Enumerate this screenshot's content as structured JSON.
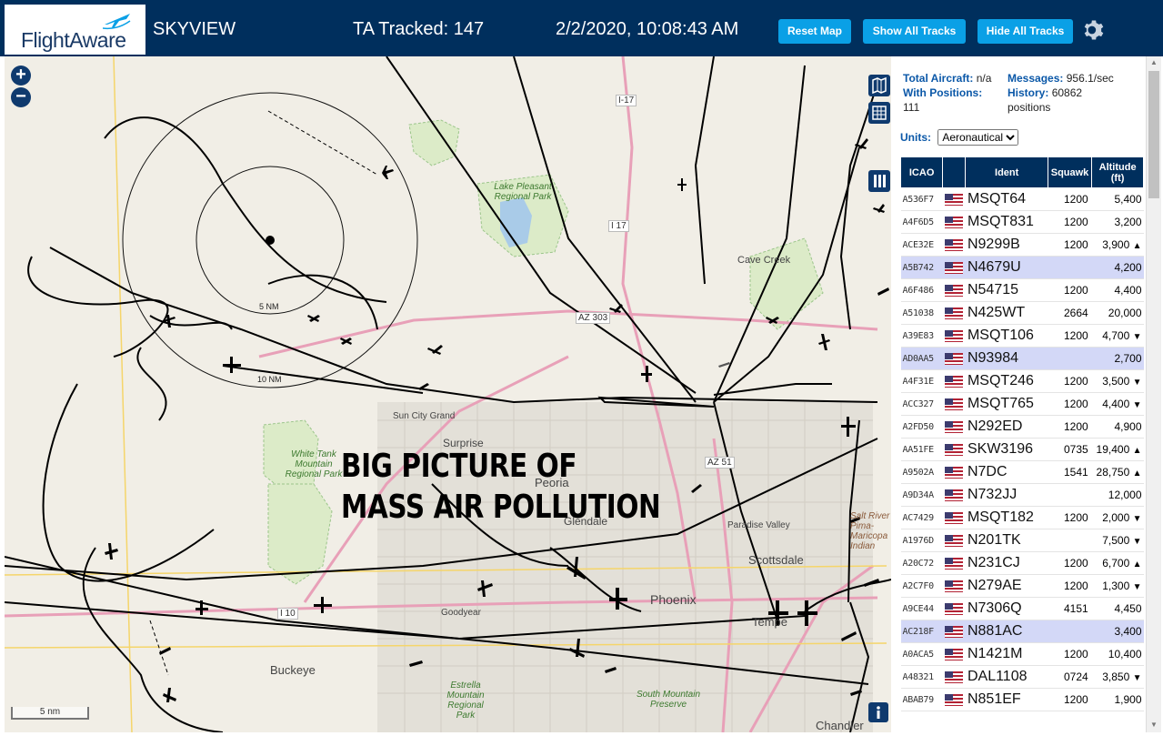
{
  "header": {
    "logo_text": "FlightAware",
    "title": "SKYVIEW",
    "tracked": "TA Tracked: 147",
    "datetime": "2/2/2020, 10:08:43 AM",
    "reset_label": "Reset Map",
    "show_label": "Show All Tracks",
    "hide_label": "Hide All Tracks"
  },
  "map": {
    "overlay_line1": "BIG PICTURE OF",
    "overlay_line2": "MASS AIR POLLUTION",
    "scale_label": "5 nm",
    "labels": [
      {
        "text": "I-17"
      },
      {
        "text": "I 17"
      },
      {
        "text": "Lake Pleasant Regional Park"
      },
      {
        "text": "Cave Creek"
      },
      {
        "text": "AZ 303"
      },
      {
        "text": "Sun City Grand"
      },
      {
        "text": "Surprise"
      },
      {
        "text": "White Tank Mountain Regional Park"
      },
      {
        "text": "Peoria"
      },
      {
        "text": "Glendale"
      },
      {
        "text": "AZ 51"
      },
      {
        "text": "Paradise Valley"
      },
      {
        "text": "Scottsdale"
      },
      {
        "text": "Phoenix"
      },
      {
        "text": "Tempe"
      },
      {
        "text": "Goodyear"
      },
      {
        "text": "I 10"
      },
      {
        "text": "Buckeye"
      },
      {
        "text": "Estrella Mountain Regional Park"
      },
      {
        "text": "South Mountain Preserve"
      },
      {
        "text": "Chandler"
      },
      {
        "text": "10 NM"
      },
      {
        "text": "5 NM"
      },
      {
        "text": "Salt River Pima-Maricopa Indian"
      }
    ]
  },
  "panel": {
    "total_label": "Total Aircraft:",
    "total_value": "n/a",
    "messages_label": "Messages:",
    "messages_value": "956.1/sec",
    "positions_label": "With Positions:",
    "positions_value": "111",
    "history_label": "History:",
    "history_value": "60862 positions",
    "units_label": "Units:",
    "units_value": "Aeronautical",
    "columns": [
      "ICAO",
      "",
      "Ident",
      "Squawk",
      "Altitude (ft)"
    ],
    "rows": [
      {
        "icao": "A536F7",
        "ident": "MSQT64",
        "squawk": "1200",
        "alt": "5,400",
        "trend": "",
        "hl": false
      },
      {
        "icao": "A4F6D5",
        "ident": "MSQT831",
        "squawk": "1200",
        "alt": "3,200",
        "trend": "",
        "hl": false
      },
      {
        "icao": "ACE32E",
        "ident": "N9299B",
        "squawk": "1200",
        "alt": "3,900",
        "trend": "▲",
        "hl": false
      },
      {
        "icao": "A5B742",
        "ident": "N4679U",
        "squawk": "",
        "alt": "4,200",
        "trend": "",
        "hl": true
      },
      {
        "icao": "A6F486",
        "ident": "N54715",
        "squawk": "1200",
        "alt": "4,400",
        "trend": "",
        "hl": false
      },
      {
        "icao": "A51038",
        "ident": "N425WT",
        "squawk": "2664",
        "alt": "20,000",
        "trend": "",
        "hl": false
      },
      {
        "icao": "A39E83",
        "ident": "MSQT106",
        "squawk": "1200",
        "alt": "4,700",
        "trend": "▼",
        "hl": false
      },
      {
        "icao": "AD0AA5",
        "ident": "N93984",
        "squawk": "",
        "alt": "2,700",
        "trend": "",
        "hl": true
      },
      {
        "icao": "A4F31E",
        "ident": "MSQT246",
        "squawk": "1200",
        "alt": "3,500",
        "trend": "▼",
        "hl": false
      },
      {
        "icao": "ACC327",
        "ident": "MSQT765",
        "squawk": "1200",
        "alt": "4,400",
        "trend": "▼",
        "hl": false
      },
      {
        "icao": "A2FD50",
        "ident": "N292ED",
        "squawk": "1200",
        "alt": "4,900",
        "trend": "",
        "hl": false
      },
      {
        "icao": "AA51FE",
        "ident": "SKW3196",
        "squawk": "0735",
        "alt": "19,400",
        "trend": "▲",
        "hl": false
      },
      {
        "icao": "A9502A",
        "ident": "N7DC",
        "squawk": "1541",
        "alt": "28,750",
        "trend": "▲",
        "hl": false
      },
      {
        "icao": "A9D34A",
        "ident": "N732JJ",
        "squawk": "",
        "alt": "12,000",
        "trend": "",
        "hl": false
      },
      {
        "icao": "AC7429",
        "ident": "MSQT182",
        "squawk": "1200",
        "alt": "2,000",
        "trend": "▼",
        "hl": false
      },
      {
        "icao": "A1976D",
        "ident": "N201TK",
        "squawk": "",
        "alt": "7,500",
        "trend": "▼",
        "hl": false
      },
      {
        "icao": "A20C72",
        "ident": "N231CJ",
        "squawk": "1200",
        "alt": "6,700",
        "trend": "▲",
        "hl": false
      },
      {
        "icao": "A2C7F0",
        "ident": "N279AE",
        "squawk": "1200",
        "alt": "1,300",
        "trend": "▼",
        "hl": false
      },
      {
        "icao": "A9CE44",
        "ident": "N7306Q",
        "squawk": "4151",
        "alt": "4,450",
        "trend": "",
        "hl": false
      },
      {
        "icao": "AC218F",
        "ident": "N881AC",
        "squawk": "",
        "alt": "3,400",
        "trend": "",
        "hl": true
      },
      {
        "icao": "A0ACA5",
        "ident": "N1421M",
        "squawk": "1200",
        "alt": "10,400",
        "trend": "",
        "hl": false
      },
      {
        "icao": "A48321",
        "ident": "DAL1108",
        "squawk": "0724",
        "alt": "3,850",
        "trend": "▼",
        "hl": false
      },
      {
        "icao": "ABAB79",
        "ident": "N851EF",
        "squawk": "1200",
        "alt": "1,900",
        "trend": "",
        "hl": false
      }
    ]
  },
  "colors": {
    "header_bg": "#002f5d",
    "button_bg": "#0aa0e6",
    "highlight_row": "#d3d8f7",
    "map_bg": "#f1eee6",
    "park_green": "#dcebc8",
    "road_pink": "#e8a0b8"
  }
}
